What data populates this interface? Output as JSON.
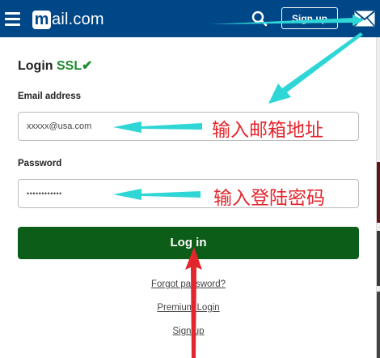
{
  "header": {
    "logo_m": "m",
    "logo_text": "ail.com",
    "signup_label": "Sign up",
    "icons": [
      "menu-icon",
      "search-icon",
      "mail-icon"
    ]
  },
  "login": {
    "title": "Login",
    "ssl": "SSL✔",
    "email_label": "Email address",
    "email_value": "xxxxx@usa.com",
    "password_label": "Password",
    "password_value": "••••••••••••",
    "login_button": "Log in",
    "forgot": "Forgot password?",
    "premium": "Premium Login",
    "signup": "Sign up"
  },
  "annotations": {
    "email_note": "输入邮箱地址",
    "password_note": "输入登陆密码",
    "color": "#e3262d",
    "arrow_color": "#2fd6d6"
  }
}
